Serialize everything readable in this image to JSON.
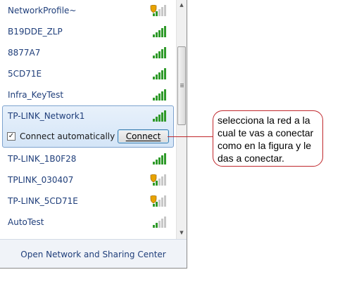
{
  "networks": [
    {
      "name": "NetworkProfile~",
      "secured": true,
      "bars": 2
    },
    {
      "name": "B19DDE_ZLP",
      "secured": false,
      "bars": 5
    },
    {
      "name": "8877A7",
      "secured": false,
      "bars": 5
    },
    {
      "name": "5CD71E",
      "secured": false,
      "bars": 5
    },
    {
      "name": "Infra_KeyTest",
      "secured": false,
      "bars": 5
    },
    {
      "name": "TP-LINK_1B0F28",
      "secured": false,
      "bars": 5
    },
    {
      "name": "TPLINK_030407",
      "secured": true,
      "bars": 2
    },
    {
      "name": "TP-LINK_5CD71E",
      "secured": true,
      "bars": 2
    },
    {
      "name": "AutoTest",
      "secured": false,
      "bars": 2
    }
  ],
  "selected_network": {
    "name": "TP-LINK_Network1",
    "bars": 5,
    "connect_automatically_label": "Connect automatically",
    "connect_automatically_checked": true,
    "connect_button_label": "Connect"
  },
  "footer": {
    "link_label": "Open Network and Sharing Center"
  },
  "annotation": {
    "text": "selecciona la red a la cual te vas a conectar como en la figura y le das a conectar."
  },
  "colors": {
    "link": "#1f3e7a",
    "signal_on": "#2f9a2a",
    "signal_off": "#c7c7c7",
    "callout_border": "#c0282c",
    "selection_border": "#7da2ce"
  }
}
